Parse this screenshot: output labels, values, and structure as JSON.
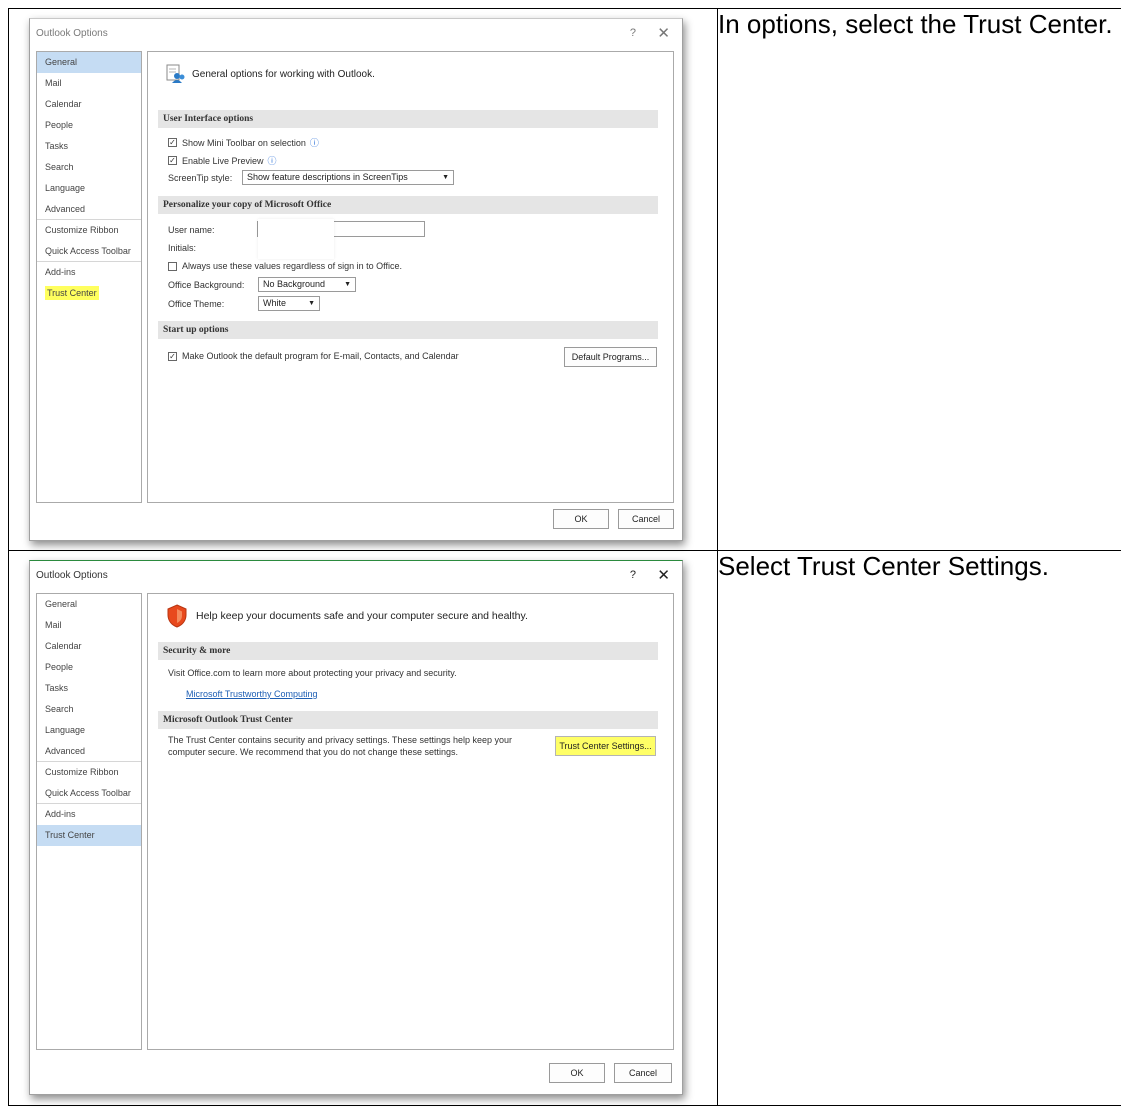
{
  "rows": [
    {
      "instruction": "In options, select the Trust Center.",
      "dialog": {
        "title": "Outlook Options",
        "help": "?",
        "close": "✕",
        "nav": [
          "General",
          "Mail",
          "Calendar",
          "People",
          "Tasks",
          "Search",
          "Language",
          "Advanced",
          "Customize Ribbon",
          "Quick Access Toolbar",
          "Add-ins",
          "Trust Center"
        ],
        "header": "General options for working with Outlook.",
        "section_ui": "User Interface options",
        "show_mini_toolbar": "Show Mini Toolbar on selection",
        "enable_live_preview": "Enable Live Preview",
        "screentip_label": "ScreenTip style:",
        "screentip_value": "Show feature descriptions in ScreenTips",
        "section_personalize": "Personalize your copy of Microsoft Office",
        "user_name_label": "User name:",
        "initials_label": "Initials:",
        "always_use": "Always use these values regardless of sign in to Office.",
        "background_label": "Office Background:",
        "background_value": "No Background",
        "theme_label": "Office Theme:",
        "theme_value": "White",
        "section_startup": "Start up options",
        "make_default": "Make Outlook the default program for E-mail, Contacts, and Calendar",
        "default_programs": "Default Programs...",
        "ok": "OK",
        "cancel": "Cancel"
      }
    },
    {
      "instruction": "Select Trust Center Settings.",
      "dialog": {
        "title": "Outlook Options",
        "help": "?",
        "close": "✕",
        "nav": [
          "General",
          "Mail",
          "Calendar",
          "People",
          "Tasks",
          "Search",
          "Language",
          "Advanced",
          "Customize Ribbon",
          "Quick Access Toolbar",
          "Add-ins",
          "Trust Center"
        ],
        "header": "Help keep your documents safe and your computer secure and healthy.",
        "section_security": "Security & more",
        "visit_text": "Visit Office.com to learn more about protecting your privacy and security.",
        "trustworthy_link": "Microsoft Trustworthy Computing",
        "section_trust": "Microsoft Outlook Trust Center",
        "trust_text_1": "The Trust Center contains security and privacy settings. These settings help keep your",
        "trust_text_2": "computer secure. We recommend that you do not change these settings.",
        "trust_settings_button": "Trust Center Settings...",
        "ok": "OK",
        "cancel": "Cancel"
      }
    }
  ],
  "colors": {
    "nav_selected": "#c5dcf3",
    "highlight": "#ffff5e",
    "link": "#1e5fb4",
    "section_header_bg": "#e5e5e5",
    "shield": "#e8491d"
  }
}
